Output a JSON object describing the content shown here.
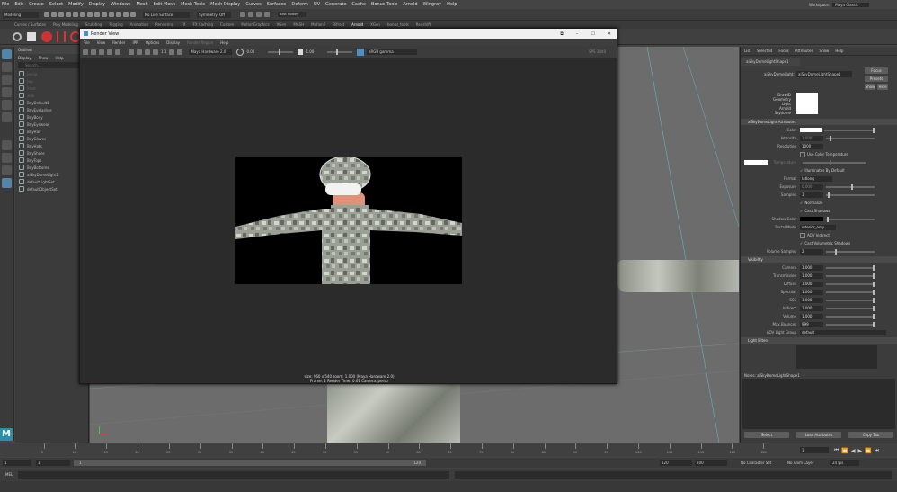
{
  "menubar": [
    "File",
    "Edit",
    "Create",
    "Select",
    "Modify",
    "Display",
    "Windows",
    "Mesh",
    "Edit Mesh",
    "Mesh Tools",
    "Mesh Display",
    "Curves",
    "Surfaces",
    "Deform",
    "UV",
    "Generate",
    "Cache",
    "Bonus Tools",
    "Arnold",
    "Wingray",
    "Help"
  ],
  "workspace": {
    "label": "Workspace:",
    "value": "Maya Classic*"
  },
  "status": {
    "mode": "Modeling",
    "symmetry": "Symmetry: Off",
    "live_surface": "No Live Surface",
    "hotkey": "Best Hotkey"
  },
  "shelf_tabs": [
    "Curves / Surfaces",
    "Poly Modeling",
    "Sculpting",
    "Rigging",
    "Animation",
    "Rendering",
    "FX",
    "FX Caching",
    "Custom",
    "MotionGraphics",
    "XGen",
    "MASH",
    "Motion2",
    "Bifrost",
    "Arnold",
    "XGen",
    "bonus_tools",
    "Redshift"
  ],
  "outliner": {
    "title": "Outliner",
    "menu": [
      "Display",
      "Show",
      "Help"
    ],
    "search_placeholder": "Search...",
    "items": [
      {
        "label": "persp",
        "dim": true
      },
      {
        "label": "top",
        "dim": true
      },
      {
        "label": "front",
        "dim": true
      },
      {
        "label": "side",
        "dim": true
      },
      {
        "label": "BoyDefault1",
        "dim": false
      },
      {
        "label": "BoyEyelashes",
        "dim": false
      },
      {
        "label": "BoyBody",
        "dim": false
      },
      {
        "label": "BoyEyewear",
        "dim": false
      },
      {
        "label": "BoyHair",
        "dim": false
      },
      {
        "label": "BoyGloves",
        "dim": false
      },
      {
        "label": "BoyHats",
        "dim": false
      },
      {
        "label": "BoyShoes",
        "dim": false
      },
      {
        "label": "BoyTops",
        "dim": false
      },
      {
        "label": "BoyBottoms",
        "dim": false
      },
      {
        "label": "aiSkyDomeLight1",
        "dim": false
      },
      {
        "label": "defaultLightSet",
        "dim": false
      },
      {
        "label": "defaultObjectSet",
        "dim": false
      }
    ]
  },
  "render_view": {
    "title": "Render View",
    "menu": [
      "File",
      "View",
      "Render",
      "IPR",
      "Options",
      "Display",
      "Render Region",
      "Help"
    ],
    "renderer": "Maya Hardware 2.0",
    "exposure": "0.00",
    "gamma": "1.00",
    "color_space": "sRGB gamma",
    "ratio": "1:1",
    "fps": "SPS 3840",
    "info_line1": "size: 960 x 540  zoom: 1.000      (Maya Hardware 2.0)",
    "info_line2": "Frame: 1      Render Time: 0:01      Camera: persp"
  },
  "attribute_editor": {
    "tabs": [
      "List",
      "Selected",
      "Focus",
      "Attributes",
      "Show",
      "Help"
    ],
    "node_tab": "aiSkyDomeLightShape1",
    "node_label": "aiSkyDomeLight:",
    "node_value": "aiSkyDomeLightShape1",
    "buttons": {
      "focus": "Focus",
      "presets": "Presets",
      "show": "Show",
      "hide": "Hide"
    },
    "swatch_labels": [
      "DrawID",
      "Geometry",
      "Light",
      "Arnold",
      "Skydome"
    ],
    "section_main": "aiSkyDomeLight Attributes",
    "color_label": "Color",
    "intensity_label": "Intensity",
    "intensity_value": "1.000",
    "resolution_label": "Resolution",
    "resolution_value": "1000",
    "use_color_temp": "Use Color Temperature",
    "temperature_label": "Temperature",
    "illuminates": "Illuminates By Default",
    "format_label": "Format",
    "format_value": "latlong",
    "exposure_label": "Exposure",
    "exposure_value": "0.000",
    "samples_label": "Samples",
    "samples_value": "1",
    "normalize": "Normalize",
    "cast_shadows": "Cast Shadows",
    "shadow_color_label": "Shadow Color",
    "portal_mode_label": "Portal Mode",
    "portal_mode_value": "interior_only",
    "aov_indirect": "AOV Indirect",
    "cast_volumetric": "Cast Volumetric Shadows",
    "volume_samples_label": "Volume Samples",
    "volume_samples_value": "2",
    "section_visibility": "Visibility",
    "visibility": [
      {
        "label": "Camera",
        "value": "1.000"
      },
      {
        "label": "Transmission",
        "value": "1.000"
      },
      {
        "label": "Diffuse",
        "value": "1.000"
      },
      {
        "label": "Specular",
        "value": "1.000"
      },
      {
        "label": "SSS",
        "value": "1.000"
      },
      {
        "label": "Indirect",
        "value": "1.000"
      },
      {
        "label": "Volume",
        "value": "1.000"
      }
    ],
    "max_bounces_label": "Max Bounces",
    "max_bounces_value": "999",
    "aov_group_label": "AOV Light Group",
    "aov_group_value": "default",
    "section_filters": "Light Filters",
    "notes": "Notes: aiSkyDomeLightShape1",
    "bottom_buttons": [
      "Select",
      "Load Attributes",
      "Copy Tab"
    ]
  },
  "timeline": {
    "ticks": [
      "5",
      "10",
      "15",
      "20",
      "25",
      "30",
      "35",
      "40",
      "45",
      "50",
      "55",
      "60",
      "65",
      "70",
      "75",
      "80",
      "85",
      "90",
      "95",
      "100",
      "105",
      "110",
      "115",
      "120"
    ],
    "current": "1"
  },
  "range": {
    "start": "1",
    "start2": "1",
    "inner": "1",
    "end_inner": "120",
    "end": "120",
    "end2": "200",
    "char_set": "No Character Set",
    "anim_layer": "No Anim Layer",
    "fps": "24 fps"
  },
  "cmdline": {
    "lang": "MEL"
  },
  "colors": {
    "accent": "#5285a6",
    "render_bg": "#2b2b2b"
  }
}
